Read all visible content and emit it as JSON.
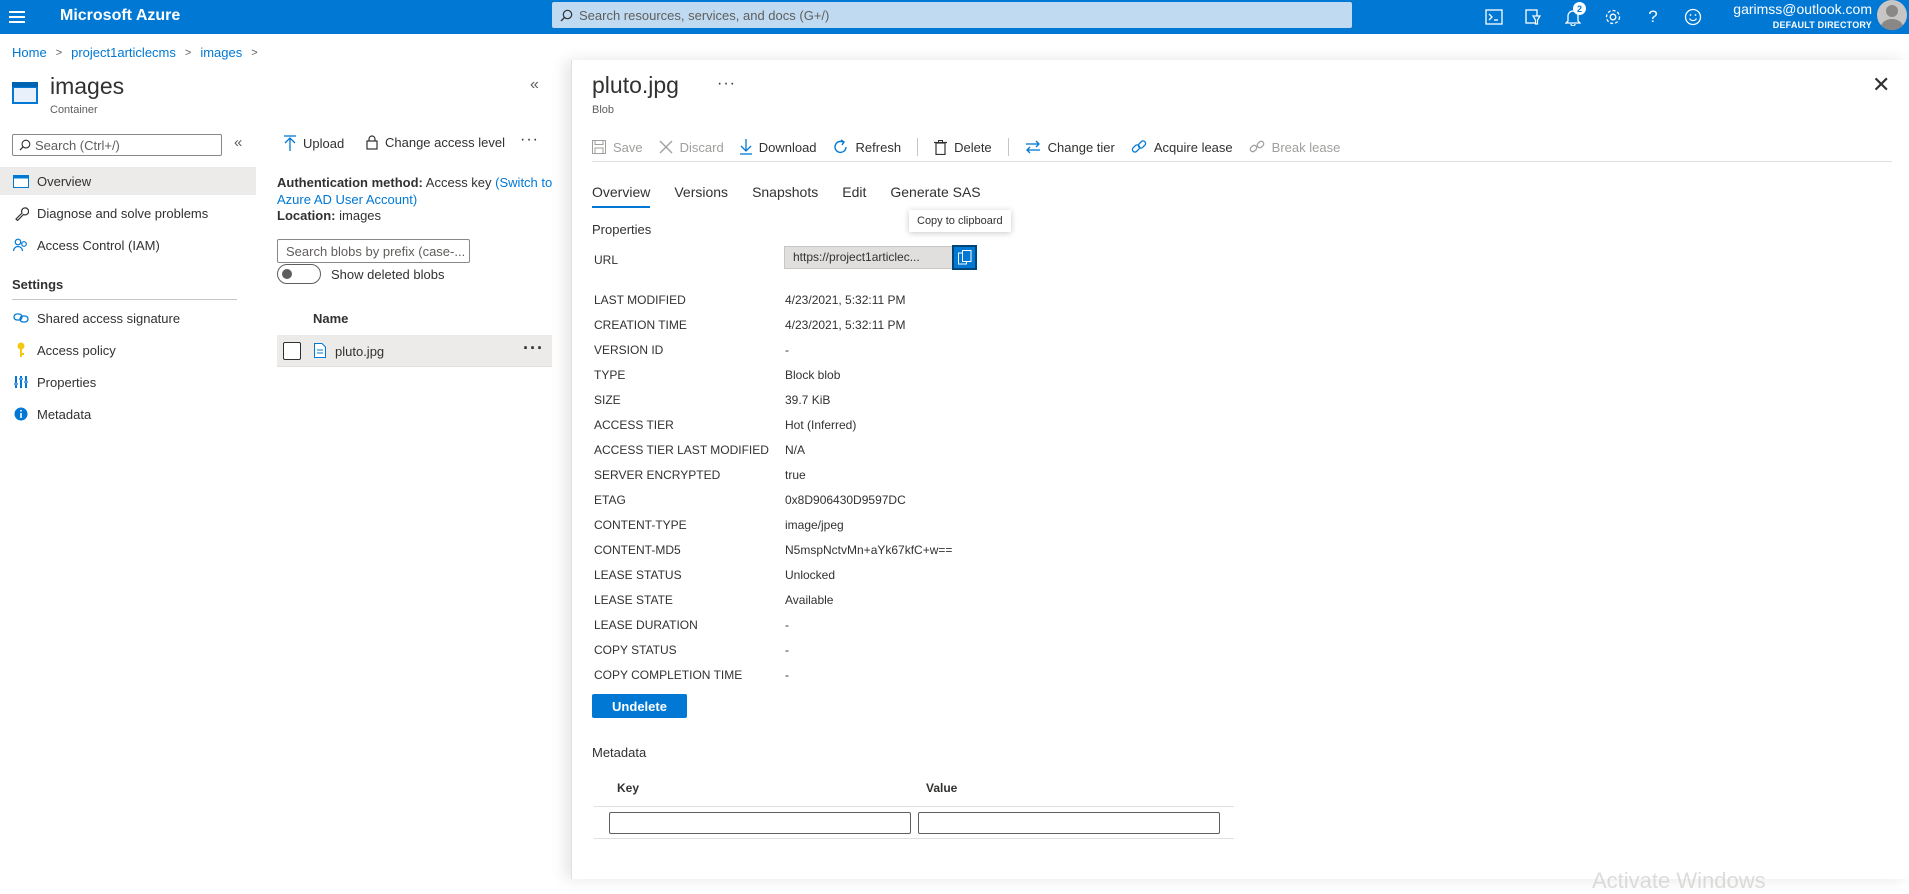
{
  "topbar": {
    "brand": "Microsoft Azure",
    "search_placeholder": "Search resources, services, and docs (G+/)",
    "notifications_count": "2",
    "account_email": "garimss@outlook.com",
    "account_directory": "DEFAULT DIRECTORY",
    "accent_color": "#0078d4"
  },
  "breadcrumb": [
    "Home",
    "project1articlecms",
    "images"
  ],
  "left_blade": {
    "title": "images",
    "subtitle": "Container",
    "menu_search_placeholder": "Search (Ctrl+/)",
    "menu": [
      {
        "label": "Overview",
        "icon": "overview-icon",
        "active": true
      },
      {
        "label": "Diagnose and solve problems",
        "icon": "wrench-icon"
      },
      {
        "label": "Access Control (IAM)",
        "icon": "people-icon"
      }
    ],
    "settings_group": "Settings",
    "settings_items": [
      {
        "label": "Shared access signature",
        "icon": "link-icon"
      },
      {
        "label": "Access policy",
        "icon": "key-icon"
      },
      {
        "label": "Properties",
        "icon": "properties-icon"
      },
      {
        "label": "Metadata",
        "icon": "info-icon"
      }
    ]
  },
  "container": {
    "commands": {
      "upload": "Upload",
      "change_access": "Change access level",
      "more": "···"
    },
    "auth_label": "Authentication method:",
    "auth_value": "Access key",
    "auth_link": "(Switch to Azure AD User Account)",
    "location_label": "Location:",
    "location_value": "images",
    "prefix_placeholder": "Search blobs by prefix (case-...",
    "show_deleted": "Show deleted blobs",
    "column_name": "Name",
    "blobs": [
      {
        "name": "pluto.jpg"
      }
    ]
  },
  "blob": {
    "title": "pluto.jpg",
    "title_more": "···",
    "subtitle": "Blob",
    "toolbar": {
      "save": "Save",
      "discard": "Discard",
      "download": "Download",
      "refresh": "Refresh",
      "delete": "Delete",
      "change_tier": "Change tier",
      "acquire_lease": "Acquire lease",
      "break_lease": "Break lease"
    },
    "tabs": [
      "Overview",
      "Versions",
      "Snapshots",
      "Edit",
      "Generate SAS"
    ],
    "active_tab": "Overview",
    "properties_label": "Properties",
    "tooltip": "Copy to clipboard",
    "url_label": "URL",
    "url_value": "https://project1articlec...",
    "properties": [
      {
        "key": "LAST MODIFIED",
        "value": "4/23/2021, 5:32:11 PM"
      },
      {
        "key": "CREATION TIME",
        "value": "4/23/2021, 5:32:11 PM"
      },
      {
        "key": "VERSION ID",
        "value": "-"
      },
      {
        "key": "TYPE",
        "value": "Block blob"
      },
      {
        "key": "SIZE",
        "value": "39.7 KiB"
      },
      {
        "key": "ACCESS TIER",
        "value": "Hot (Inferred)"
      },
      {
        "key": "ACCESS TIER LAST MODIFIED",
        "value": "N/A"
      },
      {
        "key": "SERVER ENCRYPTED",
        "value": "true"
      },
      {
        "key": "ETAG",
        "value": "0x8D906430D9597DC"
      },
      {
        "key": "CONTENT-TYPE",
        "value": "image/jpeg"
      },
      {
        "key": "CONTENT-MD5",
        "value": "N5mspNctvMn+aYk67kfC+w=="
      },
      {
        "key": "LEASE STATUS",
        "value": "Unlocked"
      },
      {
        "key": "LEASE STATE",
        "value": "Available"
      },
      {
        "key": "LEASE DURATION",
        "value": "-"
      },
      {
        "key": "COPY STATUS",
        "value": "-"
      },
      {
        "key": "COPY COMPLETION TIME",
        "value": "-"
      }
    ],
    "undelete_label": "Undelete",
    "metadata_label": "Metadata",
    "metadata_key_header": "Key",
    "metadata_value_header": "Value"
  },
  "watermark": "Activate Windows"
}
